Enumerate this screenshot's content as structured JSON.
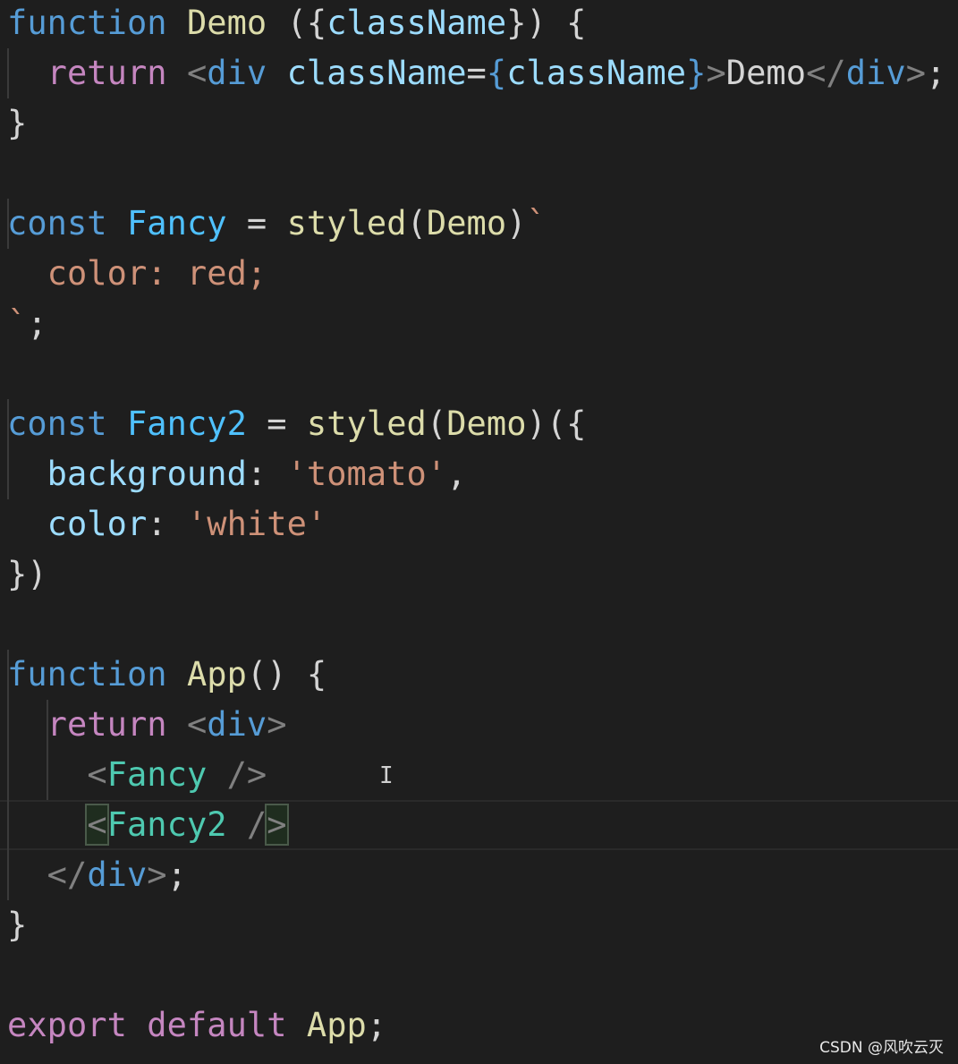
{
  "colors": {
    "background": "#1e1e1e",
    "keyword": "#569cd6",
    "function_name": "#dcdcaa",
    "variable": "#9cdcfe",
    "constant": "#4fc1ff",
    "control": "#c586c0",
    "string": "#ce9178",
    "tag_punct": "#808080",
    "component": "#4ec9b0",
    "text": "#d4d4d4"
  },
  "editor": {
    "current_line": 17,
    "lines": [
      [
        [
          "function",
          "keyword"
        ],
        [
          " ",
          "text"
        ],
        [
          "Demo",
          "function_name"
        ],
        [
          " ({",
          "text"
        ],
        [
          "className",
          "variable"
        ],
        [
          "}) {",
          "text"
        ]
      ],
      [
        [
          "  ",
          "text"
        ],
        [
          "return",
          "control"
        ],
        [
          " ",
          "text"
        ],
        [
          "<",
          "tag_punct"
        ],
        [
          "div",
          "keyword"
        ],
        [
          " ",
          "text"
        ],
        [
          "className",
          "variable"
        ],
        [
          "=",
          "text"
        ],
        [
          "{",
          "keyword"
        ],
        [
          "className",
          "variable"
        ],
        [
          "}",
          "keyword"
        ],
        [
          ">",
          "tag_punct"
        ],
        [
          "Demo",
          "text"
        ],
        [
          "</",
          "tag_punct"
        ],
        [
          "div",
          "keyword"
        ],
        [
          ">",
          "tag_punct"
        ],
        [
          ";",
          "text"
        ]
      ],
      [
        [
          "}",
          "text"
        ]
      ],
      [],
      [
        [
          "const",
          "keyword"
        ],
        [
          " ",
          "text"
        ],
        [
          "Fancy",
          "constant"
        ],
        [
          " = ",
          "text"
        ],
        [
          "styled",
          "function_name"
        ],
        [
          "(",
          "text"
        ],
        [
          "Demo",
          "function_name"
        ],
        [
          ")",
          "text"
        ],
        [
          "`",
          "string"
        ]
      ],
      [
        [
          "  ",
          "text"
        ],
        [
          "color: red;",
          "string"
        ]
      ],
      [
        [
          "`",
          "string"
        ],
        [
          ";",
          "text"
        ]
      ],
      [],
      [
        [
          "const",
          "keyword"
        ],
        [
          " ",
          "text"
        ],
        [
          "Fancy2",
          "constant"
        ],
        [
          " = ",
          "text"
        ],
        [
          "styled",
          "function_name"
        ],
        [
          "(",
          "text"
        ],
        [
          "Demo",
          "function_name"
        ],
        [
          ")({",
          "text"
        ]
      ],
      [
        [
          "  ",
          "text"
        ],
        [
          "background",
          "variable"
        ],
        [
          ": ",
          "text"
        ],
        [
          "'tomato'",
          "string"
        ],
        [
          ",",
          "text"
        ]
      ],
      [
        [
          "  ",
          "text"
        ],
        [
          "color",
          "variable"
        ],
        [
          ": ",
          "text"
        ],
        [
          "'white'",
          "string"
        ]
      ],
      [
        [
          "})",
          "text"
        ]
      ],
      [],
      [
        [
          "function",
          "keyword"
        ],
        [
          " ",
          "text"
        ],
        [
          "App",
          "function_name"
        ],
        [
          "() {",
          "text"
        ]
      ],
      [
        [
          "  ",
          "text"
        ],
        [
          "return",
          "control"
        ],
        [
          " ",
          "text"
        ],
        [
          "<",
          "tag_punct"
        ],
        [
          "div",
          "keyword"
        ],
        [
          ">",
          "tag_punct"
        ]
      ],
      [
        [
          "    ",
          "text"
        ],
        [
          "<",
          "tag_punct"
        ],
        [
          "Fancy",
          "component"
        ],
        [
          " />",
          "tag_punct"
        ]
      ],
      [
        [
          "    ",
          "text"
        ],
        [
          "<",
          "tag_punct",
          "match"
        ],
        [
          "Fancy2",
          "component"
        ],
        [
          " /",
          "tag_punct"
        ],
        [
          ">",
          "tag_punct",
          "match"
        ]
      ],
      [
        [
          "  ",
          "text"
        ],
        [
          "</",
          "tag_punct"
        ],
        [
          "div",
          "keyword"
        ],
        [
          ">",
          "tag_punct"
        ],
        [
          ";",
          "text"
        ]
      ],
      [
        [
          "}",
          "text"
        ]
      ],
      [],
      [
        [
          "export",
          "control"
        ],
        [
          " ",
          "text"
        ],
        [
          "default",
          "control"
        ],
        [
          " ",
          "text"
        ],
        [
          "App",
          "function_name"
        ],
        [
          ";",
          "text"
        ]
      ]
    ]
  },
  "watermark": "CSDN @风吹云灭",
  "cursor_icon": "text-cursor-icon"
}
